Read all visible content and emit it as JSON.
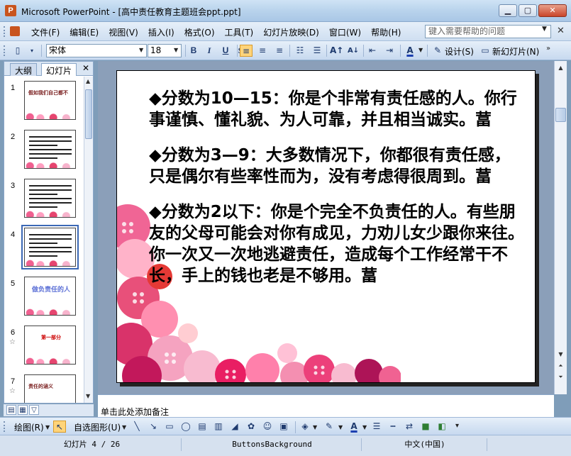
{
  "window": {
    "title": "Microsoft PowerPoint - [高中责任教育主题班会ppt.ppt]",
    "buttons": {
      "minimize": "▁",
      "maximize": "▢",
      "close": "✕"
    }
  },
  "menu": {
    "items": [
      "文件(F)",
      "编辑(E)",
      "视图(V)",
      "插入(I)",
      "格式(O)",
      "工具(T)",
      "幻灯片放映(D)",
      "窗口(W)",
      "帮助(H)"
    ],
    "help_placeholder": "键入需要帮助的问题",
    "doc_close": "✕"
  },
  "toolbar": {
    "font": "宋体",
    "size": "18",
    "bold": "B",
    "italic": "I",
    "underline": "U",
    "design_label": "设计(S)",
    "new_slide_label": "新幻灯片(N)"
  },
  "panel": {
    "tabs": [
      "大纲",
      "幻灯片"
    ],
    "close": "✕",
    "slides": [
      {
        "num": "1",
        "title": "假如我们自己都不",
        "style": "dark",
        "star": false
      },
      {
        "num": "2",
        "title": "",
        "style": "text",
        "star": false
      },
      {
        "num": "3",
        "title": "",
        "style": "text",
        "star": false
      },
      {
        "num": "4",
        "title": "",
        "style": "text",
        "star": false
      },
      {
        "num": "5",
        "title": "做负责任的人",
        "style": "blue",
        "star": false
      },
      {
        "num": "6",
        "title": "第一部分",
        "style": "red",
        "star": true
      },
      {
        "num": "7",
        "title": "责任的涵义",
        "style": "dark",
        "star": true
      }
    ]
  },
  "slide": {
    "paragraphs": [
      "◆分数为10—15：你是个非常有责任感的人。你行事谨慎、懂礼貌、为人可靠，并且相当诚实。葍",
      "◆分数为3—9：大多数情况下，你都很有责任感，只是偶尔有些率性而为，没有考虑得很周到。葍",
      " ◆分数为2以下：你是个完全不负责任的人。有些朋友的父母可能会对你有成见，力劝儿女少跟你来往。你一次又一次地逃避责任，造成每个工作经常干不长，手上的钱也老是不够用。葍"
    ]
  },
  "notes": {
    "placeholder": "单击此处添加备注"
  },
  "drawbar": {
    "draw_label": "绘图(R)",
    "autoshape_label": "自选图形(U)"
  },
  "status": {
    "slide_info": "幻灯片 4 / 26",
    "design": "ButtonsBackground",
    "language": "中文(中国)"
  }
}
